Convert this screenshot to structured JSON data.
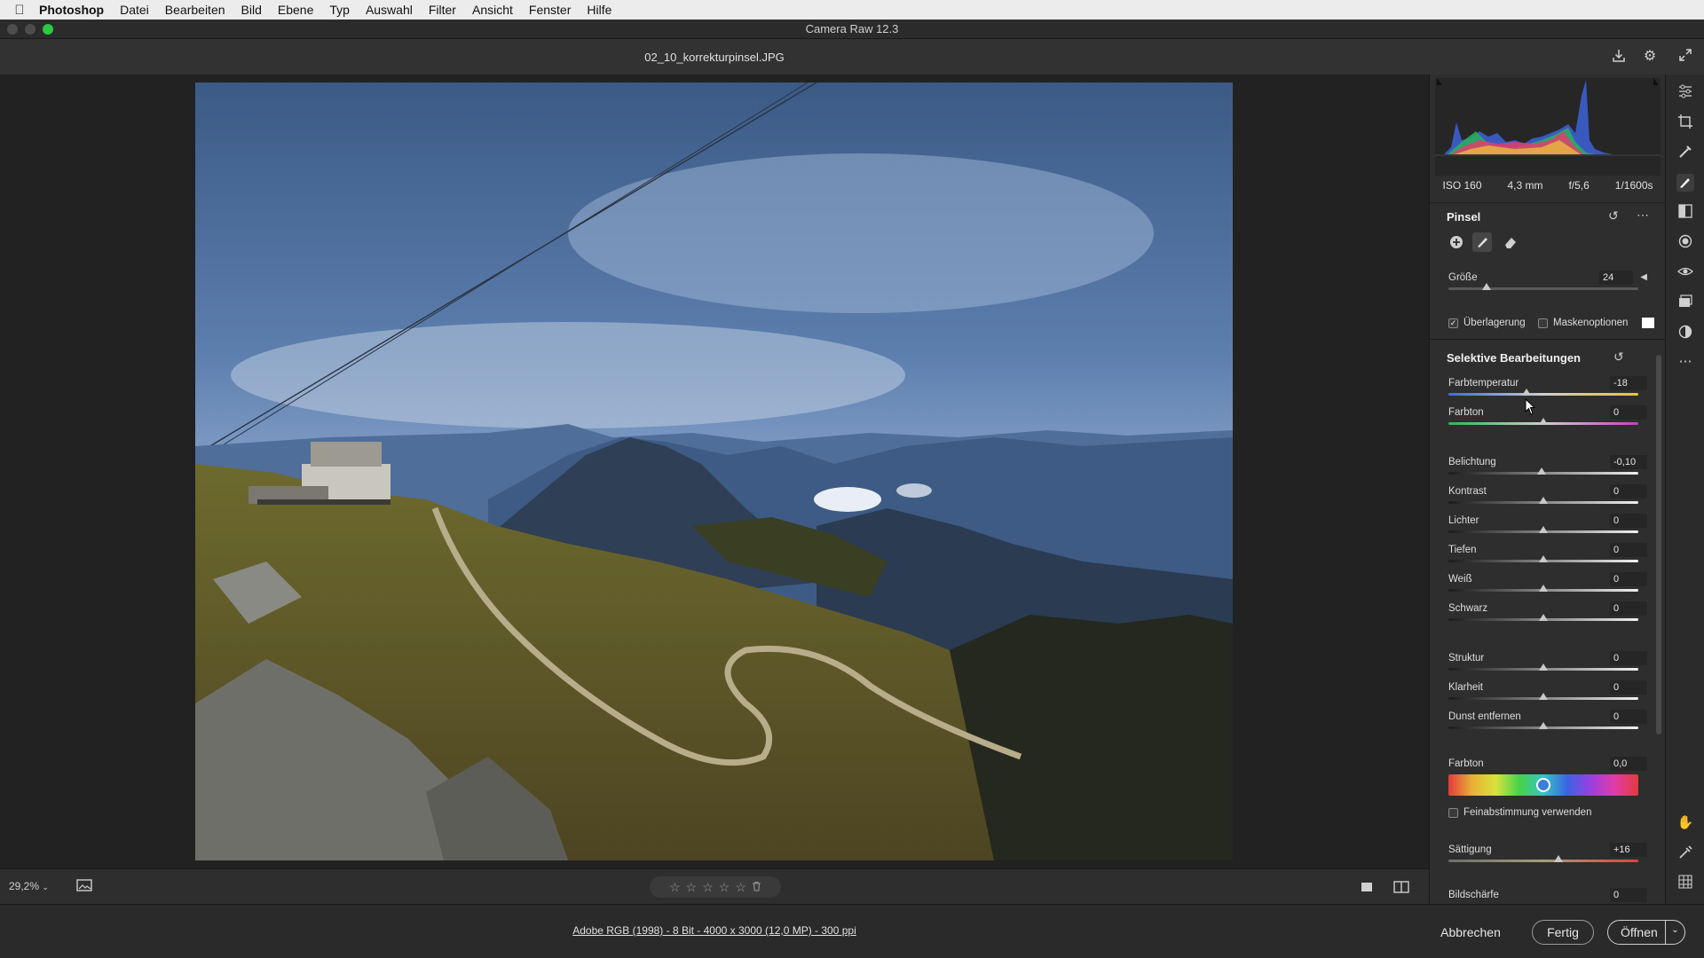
{
  "menubar": {
    "app": "Photoshop",
    "items": [
      "Datei",
      "Bearbeiten",
      "Bild",
      "Ebene",
      "Typ",
      "Auswahl",
      "Filter",
      "Ansicht",
      "Fenster",
      "Hilfe"
    ]
  },
  "window": {
    "title": "Camera Raw 12.3"
  },
  "file": {
    "name": "02_10_korrekturpinsel.JPG"
  },
  "exif": {
    "iso": "ISO 160",
    "focal": "4,3 mm",
    "aperture": "f/5,6",
    "shutter": "1/1600s"
  },
  "brush": {
    "title": "Pinsel",
    "size_label": "Größe",
    "size_value": "24",
    "size_level": 0.2,
    "overlay_label": "Überlagerung",
    "overlay_checked": true,
    "mask_label": "Maskenoptionen",
    "mask_checked": false
  },
  "selective": {
    "title": "Selektive Bearbeitungen",
    "sliders": [
      {
        "label": "Farbtemperatur",
        "value": "-18",
        "level": 0.41,
        "track": "temp"
      },
      {
        "label": "Farbton",
        "value": "0",
        "level": 0.5,
        "track": "tint"
      },
      {
        "label": "Belichtung",
        "value": "-0,10",
        "level": 0.49,
        "track": "plain"
      },
      {
        "label": "Kontrast",
        "value": "0",
        "level": 0.5,
        "track": "plain"
      },
      {
        "label": "Lichter",
        "value": "0",
        "level": 0.5,
        "track": "plain"
      },
      {
        "label": "Tiefen",
        "value": "0",
        "level": 0.5,
        "track": "plain"
      },
      {
        "label": "Weiß",
        "value": "0",
        "level": 0.5,
        "track": "plain"
      },
      {
        "label": "Schwarz",
        "value": "0",
        "level": 0.5,
        "track": "plain"
      },
      {
        "label": "Struktur",
        "value": "0",
        "level": 0.5,
        "track": "plain"
      },
      {
        "label": "Klarheit",
        "value": "0",
        "level": 0.5,
        "track": "plain"
      },
      {
        "label": "Dunst entfernen",
        "value": "0",
        "level": 0.5,
        "track": "plain"
      }
    ],
    "hue_label": "Farbton",
    "hue_value": "0,0",
    "finetune_label": "Feinabstimmung verwenden",
    "finetune_checked": false,
    "saturation": {
      "label": "Sättigung",
      "value": "+16",
      "level": 0.58
    },
    "sharpness": {
      "label": "Bildschärfe",
      "value": "0"
    }
  },
  "canvas": {
    "zoom": "29,2%",
    "rating_stars": 5
  },
  "footer": {
    "info": "Adobe RGB (1998) - 8 Bit - 4000 x 3000 (12,0 MP) - 300 ppi",
    "cancel": "Abbrechen",
    "done": "Fertig",
    "open": "Öffnen"
  },
  "colors": {
    "accent": "#3b8ee8",
    "panel": "#2e2e2e",
    "canvas": "#222222"
  }
}
